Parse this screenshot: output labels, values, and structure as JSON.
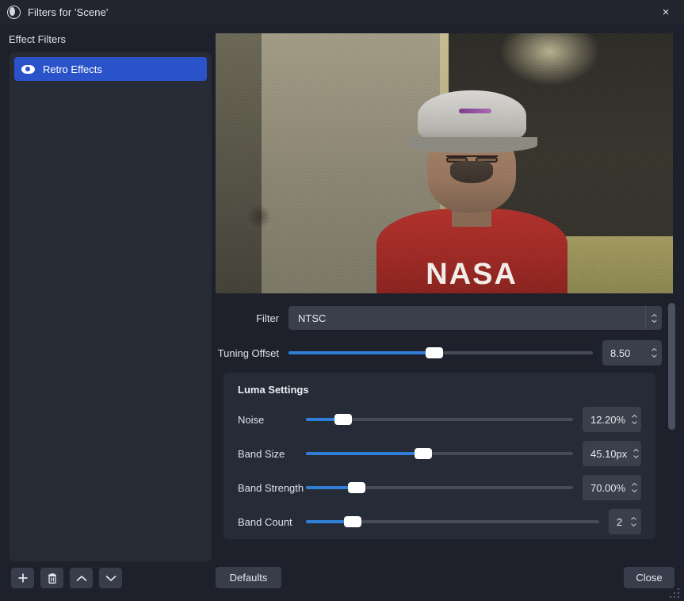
{
  "window": {
    "title": "Filters for 'Scene'",
    "logo_icon": "obs-logo-icon",
    "close_icon": "×"
  },
  "sidebar": {
    "header": "Effect Filters",
    "items": [
      {
        "label": "Retro Effects",
        "icon": "eye-icon",
        "selected": true
      }
    ],
    "toolbar": [
      {
        "name": "add-filter-button",
        "icon": "plus-icon"
      },
      {
        "name": "remove-filter-button",
        "icon": "trash-icon"
      },
      {
        "name": "move-filter-up-button",
        "icon": "chevron-up-icon"
      },
      {
        "name": "move-filter-down-button",
        "icon": "chevron-down-icon"
      }
    ]
  },
  "preview": {
    "shirt_text": "NASA"
  },
  "settings": {
    "filter": {
      "label": "Filter",
      "value": "NTSC"
    },
    "tuning_offset": {
      "label": "Tuning Offset",
      "value": "8.50",
      "percent": 48
    },
    "group": {
      "title": "Luma Settings",
      "rows": [
        {
          "label": "Noise",
          "value": "12.20%",
          "percent": 14
        },
        {
          "label": "Band Size",
          "value": "45.10px",
          "percent": 44
        },
        {
          "label": "Band Strength",
          "value": "70.00%",
          "percent": 19
        },
        {
          "label": "Band Count",
          "value": "2",
          "percent": 16
        }
      ]
    }
  },
  "footer": {
    "defaults_label": "Defaults",
    "close_label": "Close"
  },
  "colors": {
    "accent_blue": "#2a52c9",
    "slider_blue": "#2f7fd6",
    "panel": "#262b38",
    "background": "#1e212b"
  }
}
